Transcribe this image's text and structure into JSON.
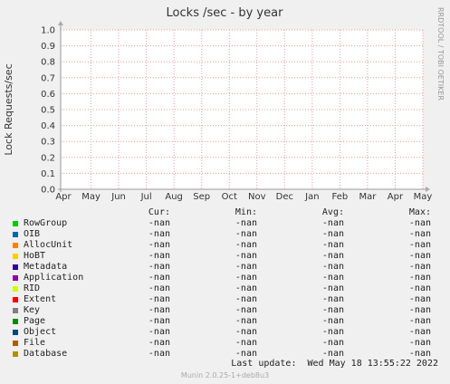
{
  "chart_data": {
    "type": "line",
    "title": "Locks /sec - by year",
    "ylabel": "Lock Requests/sec",
    "ylim": [
      0,
      1.0
    ],
    "y_ticks": [
      "0.0",
      "0.1",
      "0.2",
      "0.3",
      "0.4",
      "0.5",
      "0.6",
      "0.7",
      "0.8",
      "0.9",
      "1.0"
    ],
    "x_ticks": [
      "Apr",
      "May",
      "Jun",
      "Jul",
      "Aug",
      "Sep",
      "Oct",
      "Nov",
      "Dec",
      "Jan",
      "Feb",
      "Mar",
      "Apr",
      "May"
    ],
    "grid": true,
    "series": [
      {
        "name": "RowGroup",
        "color": "#00cc00",
        "values": []
      },
      {
        "name": "OIB",
        "color": "#0066b3",
        "values": []
      },
      {
        "name": "AllocUnit",
        "color": "#ff8000",
        "values": []
      },
      {
        "name": "HoBT",
        "color": "#ffcc00",
        "values": []
      },
      {
        "name": "Metadata",
        "color": "#330099",
        "values": []
      },
      {
        "name": "Application",
        "color": "#990099",
        "values": []
      },
      {
        "name": "RID",
        "color": "#ccff00",
        "values": []
      },
      {
        "name": "Extent",
        "color": "#ff0000",
        "values": []
      },
      {
        "name": "Key",
        "color": "#808080",
        "values": []
      },
      {
        "name": "Page",
        "color": "#008f00",
        "values": []
      },
      {
        "name": "Object",
        "color": "#00487d",
        "values": []
      },
      {
        "name": "File",
        "color": "#b35a00",
        "values": []
      },
      {
        "name": "Database",
        "color": "#b38f00",
        "values": []
      }
    ]
  },
  "side_label": "RRDTOOL / TOBI OETIKER",
  "legend": {
    "headers": [
      "Cur:",
      "Min:",
      "Avg:",
      "Max:"
    ],
    "rows": [
      {
        "name": "RowGroup",
        "cur": "-nan",
        "min": "-nan",
        "avg": "-nan",
        "max": "-nan"
      },
      {
        "name": "OIB",
        "cur": "-nan",
        "min": "-nan",
        "avg": "-nan",
        "max": "-nan"
      },
      {
        "name": "AllocUnit",
        "cur": "-nan",
        "min": "-nan",
        "avg": "-nan",
        "max": "-nan"
      },
      {
        "name": "HoBT",
        "cur": "-nan",
        "min": "-nan",
        "avg": "-nan",
        "max": "-nan"
      },
      {
        "name": "Metadata",
        "cur": "-nan",
        "min": "-nan",
        "avg": "-nan",
        "max": "-nan"
      },
      {
        "name": "Application",
        "cur": "-nan",
        "min": "-nan",
        "avg": "-nan",
        "max": "-nan"
      },
      {
        "name": "RID",
        "cur": "-nan",
        "min": "-nan",
        "avg": "-nan",
        "max": "-nan"
      },
      {
        "name": "Extent",
        "cur": "-nan",
        "min": "-nan",
        "avg": "-nan",
        "max": "-nan"
      },
      {
        "name": "Key",
        "cur": "-nan",
        "min": "-nan",
        "avg": "-nan",
        "max": "-nan"
      },
      {
        "name": "Page",
        "cur": "-nan",
        "min": "-nan",
        "avg": "-nan",
        "max": "-nan"
      },
      {
        "name": "Object",
        "cur": "-nan",
        "min": "-nan",
        "avg": "-nan",
        "max": "-nan"
      },
      {
        "name": "File",
        "cur": "-nan",
        "min": "-nan",
        "avg": "-nan",
        "max": "-nan"
      },
      {
        "name": "Database",
        "cur": "-nan",
        "min": "-nan",
        "avg": "-nan",
        "max": "-nan"
      }
    ]
  },
  "last_update": "Last update:  Wed May 18 13:55:22 2022",
  "footer": "Munin 2.0.25-1+deb8u3"
}
